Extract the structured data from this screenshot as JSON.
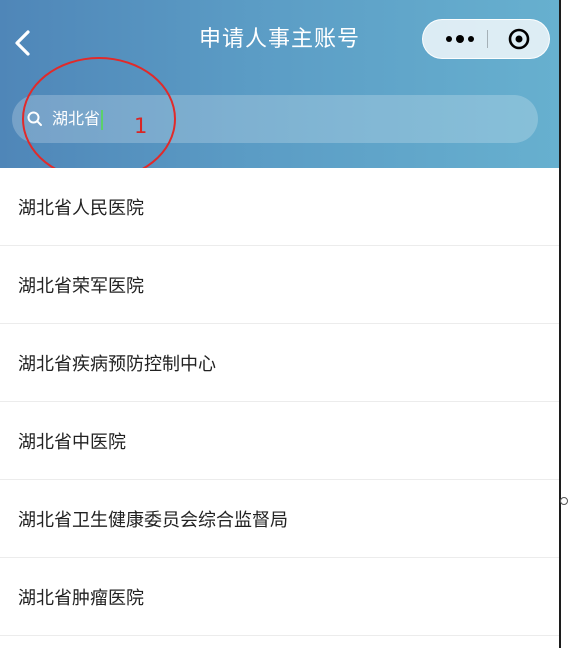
{
  "header": {
    "title": "申请人事主账号",
    "back_icon": "chevron-left-icon",
    "capsule": {
      "more_icon": "more-dots-icon",
      "close_icon": "target-circle-icon"
    },
    "gradient": [
      "#4f86b8",
      "#67b0cf"
    ]
  },
  "search": {
    "icon": "search-icon",
    "value": "湖北省"
  },
  "annotation": {
    "label": "1",
    "color": "#e12a2a"
  },
  "results": [
    {
      "label": "湖北省人民医院"
    },
    {
      "label": "湖北省荣军医院"
    },
    {
      "label": "湖北省疾病预防控制中心"
    },
    {
      "label": "湖北省中医院"
    },
    {
      "label": "湖北省卫生健康委员会综合监督局"
    },
    {
      "label": "湖北省肿瘤医院"
    }
  ]
}
